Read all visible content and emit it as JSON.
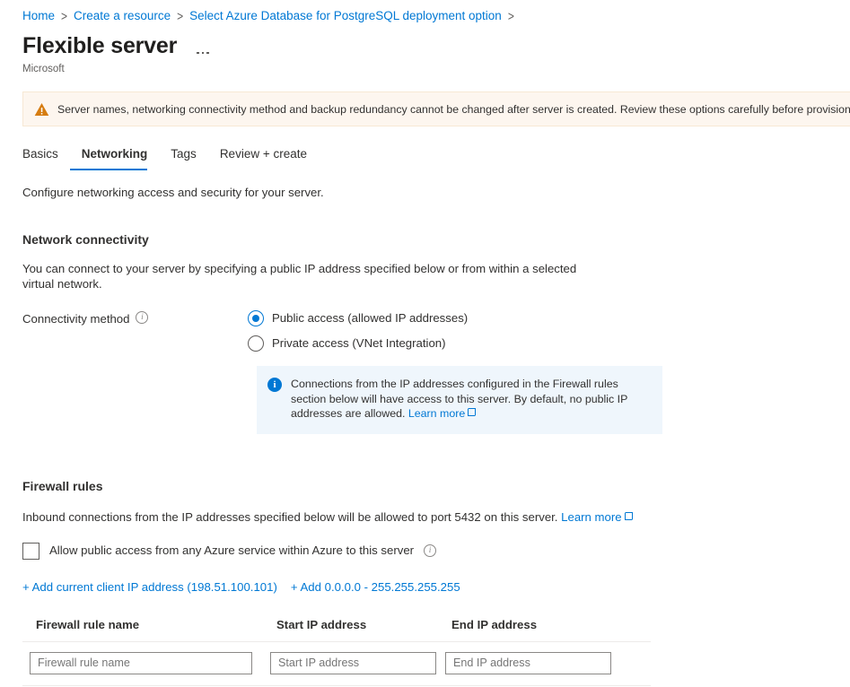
{
  "breadcrumb": {
    "items": [
      {
        "label": "Home"
      },
      {
        "label": "Create a resource"
      },
      {
        "label": "Select Azure Database for PostgreSQL deployment option"
      }
    ],
    "separator": ">"
  },
  "header": {
    "title": "Flexible server",
    "publisher": "Microsoft",
    "more_menu": "ellipsis-menu"
  },
  "warning_banner": {
    "icon": "warning-triangle-icon",
    "text": "Server names, networking connectivity method and backup redundancy cannot be changed after server is created. Review these options carefully before provisioning",
    "background": "#fdf6ef",
    "icon_color": "#d67c10"
  },
  "tabs": [
    {
      "label": "Basics",
      "active": false
    },
    {
      "label": "Networking",
      "active": true
    },
    {
      "label": "Tags",
      "active": false
    },
    {
      "label": "Review + create",
      "active": false
    }
  ],
  "tab_description": "Configure networking access and security for your server.",
  "network_connectivity": {
    "title": "Network connectivity",
    "description": "You can connect to your server by specifying a public IP address specified below or from within a selected virtual network.",
    "connectivity_method": {
      "label": "Connectivity method",
      "info_icon": "info-icon",
      "options": [
        {
          "label": "Public access (allowed IP addresses)",
          "selected": true
        },
        {
          "label": "Private access (VNet Integration)",
          "selected": false
        }
      ]
    },
    "info_box": {
      "icon": "info-filled-icon",
      "text": "Connections from the IP addresses configured in the Firewall rules section below will have access to this server. By default, no public IP addresses are allowed.",
      "link_label": "Learn more",
      "background": "#eff6fc"
    }
  },
  "firewall_rules": {
    "title": "Firewall rules",
    "description": "Inbound connections from the IP addresses specified below will be allowed to port 5432 on this server.",
    "link_label": "Learn more",
    "allow_azure_services": {
      "label": "Allow public access from any Azure service within Azure to this server",
      "checked": false,
      "info_icon": "info-icon"
    },
    "actions": [
      {
        "label": "+ Add current client IP address (198.51.100.101)"
      },
      {
        "label": "+ Add 0.0.0.0 - 255.255.255.255"
      }
    ],
    "table": {
      "columns": [
        "Firewall rule name",
        "Start IP address",
        "End IP address"
      ],
      "rows": [
        {
          "name_placeholder": "Firewall rule name",
          "name_value": "",
          "start_placeholder": "Start IP address",
          "start_value": "",
          "end_placeholder": "End IP address",
          "end_value": ""
        }
      ]
    }
  },
  "colors": {
    "accent": "#0078d4",
    "warning": "#d67c10",
    "text": "#323130",
    "muted": "#605e5c"
  }
}
